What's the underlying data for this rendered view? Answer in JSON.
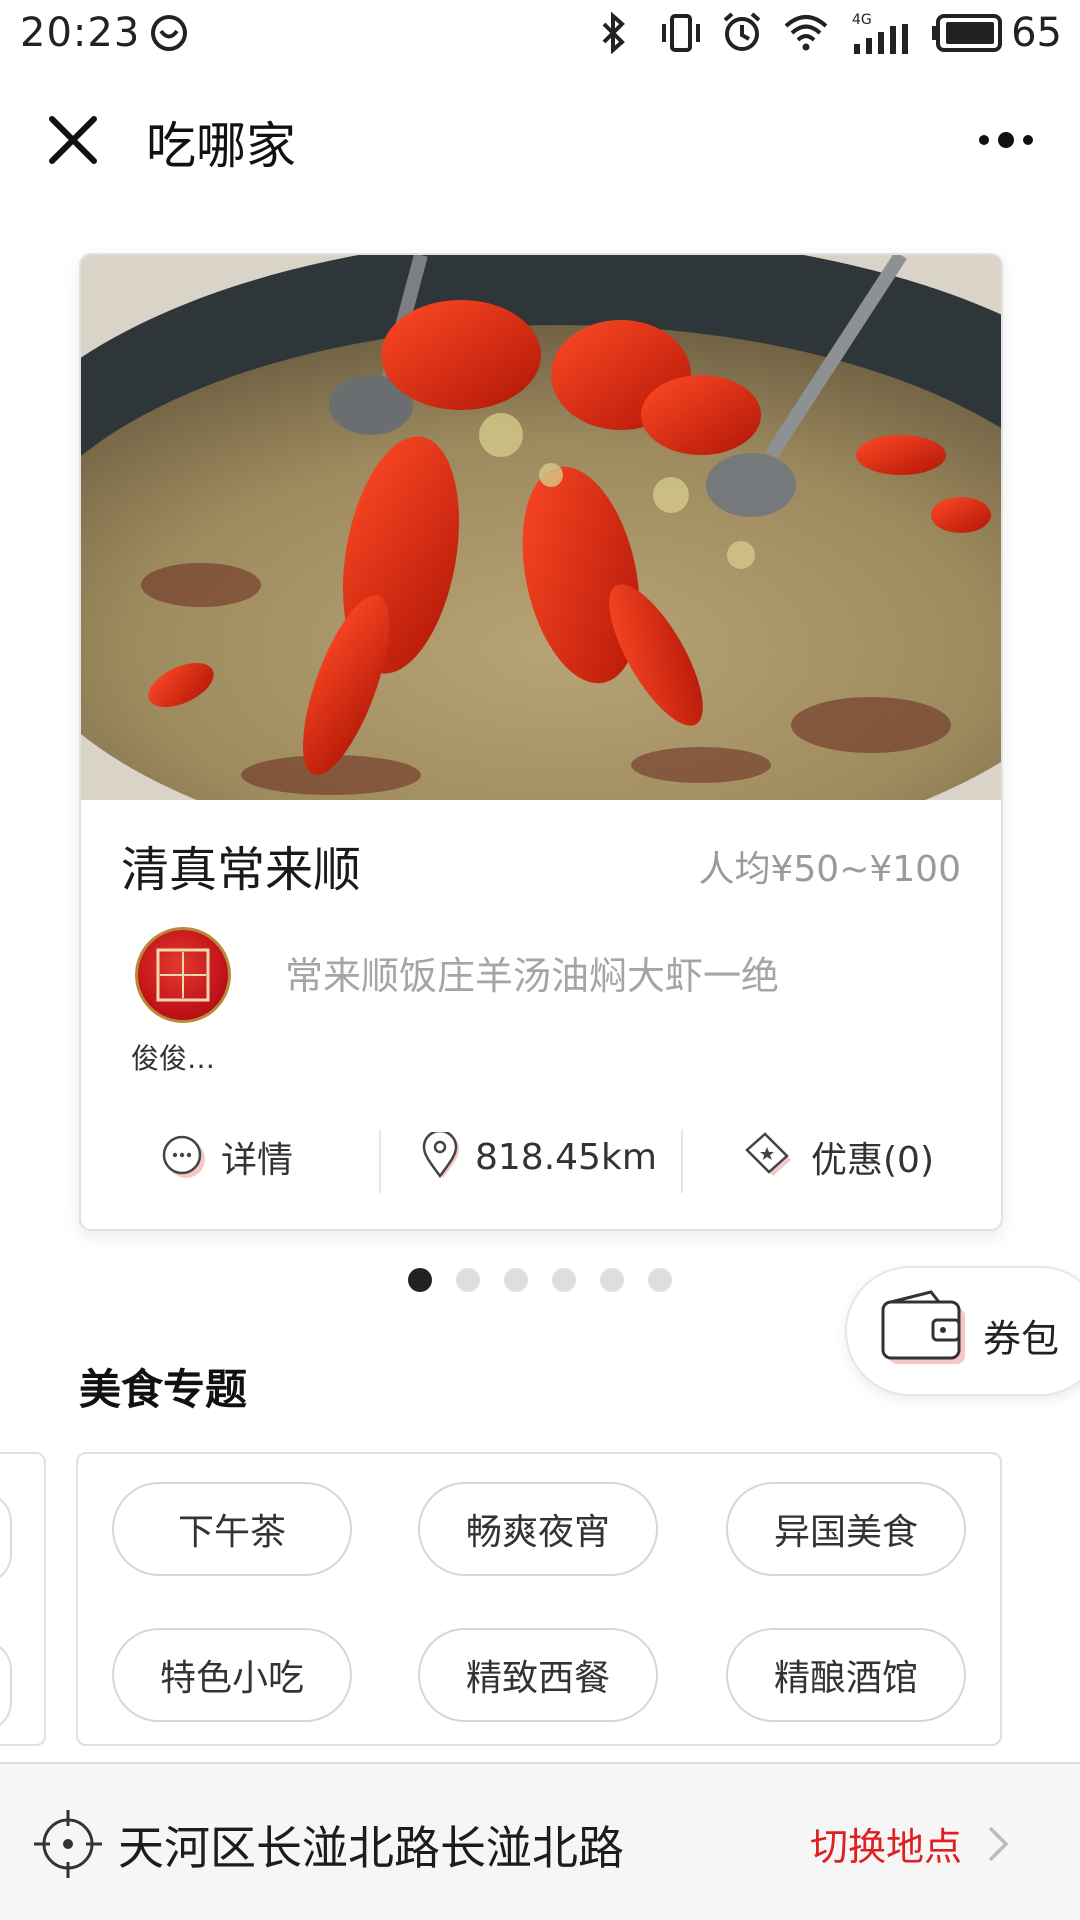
{
  "status_bar": {
    "time": "20:23",
    "network": "4G",
    "battery": "65"
  },
  "header": {
    "title": "吃哪家"
  },
  "restaurant_card": {
    "name": "清真常来顺",
    "price": "人均¥50~¥100",
    "author_name": "俊俊…",
    "tagline": "常来顺饭庄羊汤油焖大虾一绝",
    "actions": {
      "details": "详情",
      "distance": "818.45km",
      "deals": "优惠(0)"
    }
  },
  "pager": {
    "count": 6,
    "active_index": 0
  },
  "coupon": {
    "label": "券包"
  },
  "topics": {
    "title": "美食专题",
    "items": [
      "下午茶",
      "畅爽夜宵",
      "异国美食",
      "特色小吃",
      "精致西餐",
      "精酿酒馆"
    ]
  },
  "location": {
    "address": "天河区长湴北路长湴北路",
    "switch_label": "切换地点"
  },
  "colors": {
    "accent": "#e02020",
    "text_primary": "#222222",
    "text_muted": "#a5a5a5"
  }
}
